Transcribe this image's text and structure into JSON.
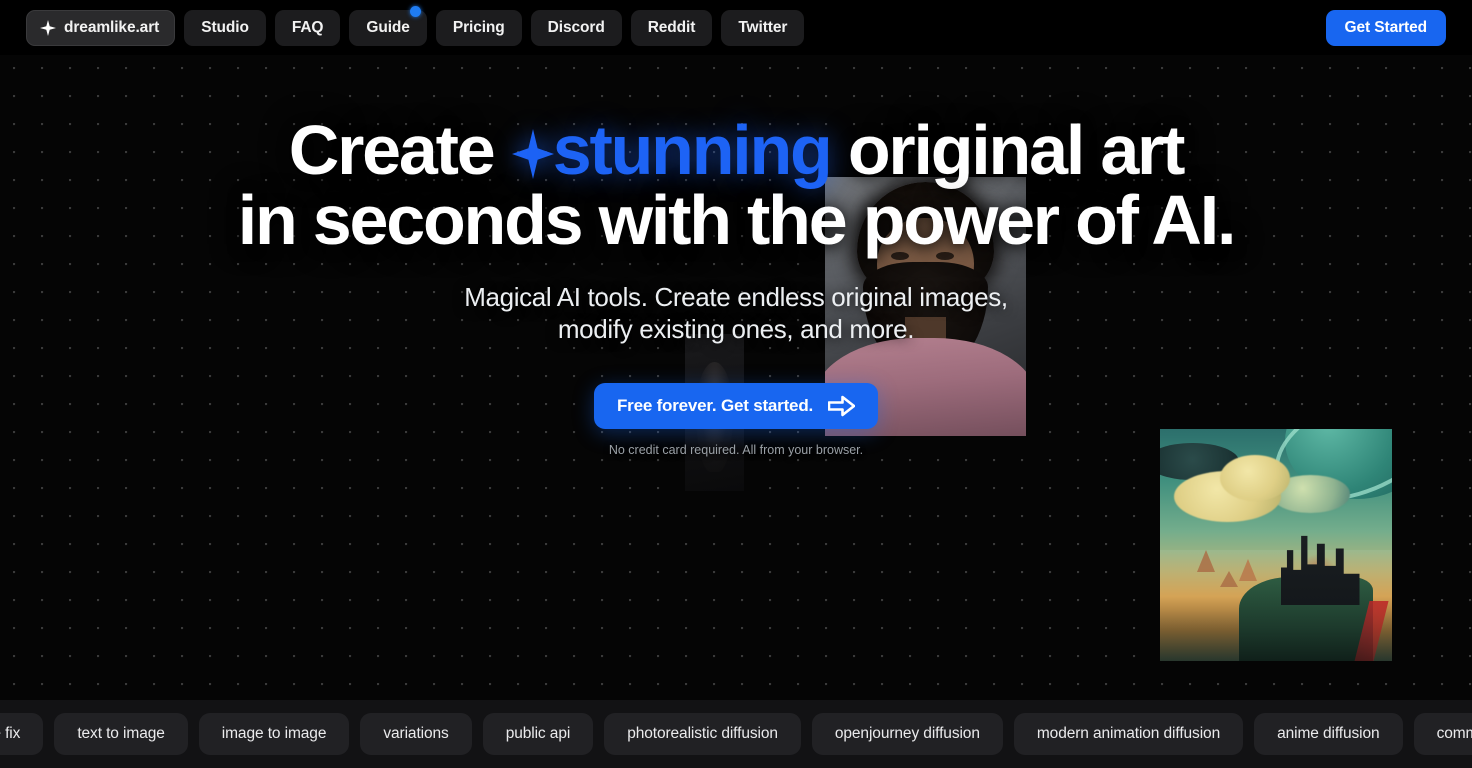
{
  "site": {
    "brand": "dreamlike.art",
    "accent_color": "#1866f0",
    "background_color": "#000000",
    "hero_background_color": "#050505",
    "tag_rail_background": "#121214"
  },
  "navbar": {
    "brand_label": "dreamlike.art",
    "brand_icon": "sparkle-icon",
    "items": [
      {
        "label": "Studio",
        "badge": false
      },
      {
        "label": "FAQ",
        "badge": false
      },
      {
        "label": "Guide",
        "badge": true
      },
      {
        "label": "Pricing",
        "badge": false
      },
      {
        "label": "Discord",
        "badge": false
      },
      {
        "label": "Reddit",
        "badge": false
      },
      {
        "label": "Twitter",
        "badge": false
      }
    ],
    "cta_label": "Get Started"
  },
  "hero": {
    "headline_line1_pre": "Create ",
    "headline_accent": "stunning",
    "headline_line1_post": " original art",
    "headline_line2": "in seconds with the power of AI.",
    "headline_spark_icon": "sparkle-icon",
    "subhead_line1": "Magical AI tools. Create endless original images,",
    "subhead_line2": "modify existing ones, and more.",
    "cta_label": "Free forever. Get started.",
    "cta_arrow_icon": "arrow-right-icon",
    "cta_note": "No credit card required. All from your browser.",
    "artworks": [
      {
        "name": "portrait-bearded-man",
        "alt": "Generated portrait of a bearded man in a pink hoodie"
      },
      {
        "name": "fantasy-castle-landscape",
        "alt": "Generated teal fantasy landscape with ringed planet and cliff castle"
      },
      {
        "name": "dim-portrait",
        "alt": "Dimmed generated portrait thumbnail"
      }
    ]
  },
  "tag_rail": {
    "tags": [
      "face fix",
      "text to image",
      "image to image",
      "variations",
      "public api",
      "photorealistic diffusion",
      "openjourney diffusion",
      "modern animation diffusion",
      "anime diffusion",
      "community"
    ]
  }
}
